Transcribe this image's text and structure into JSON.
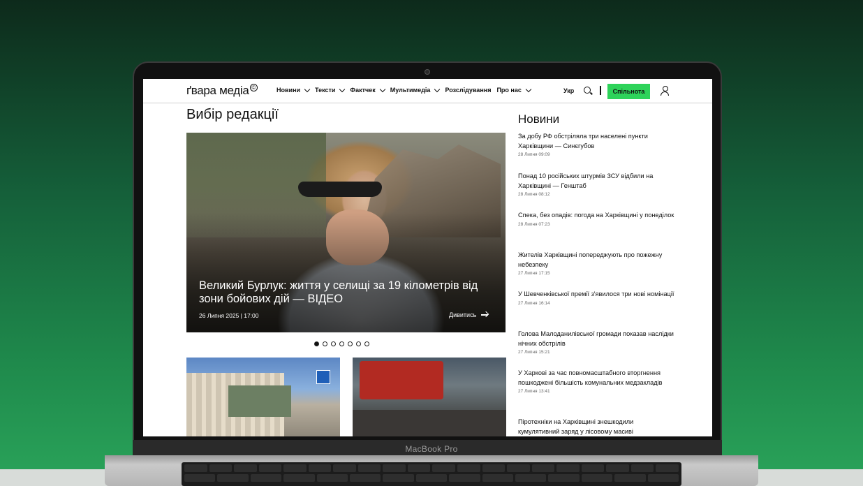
{
  "device": {
    "brand": "MacBook Pro"
  },
  "site": {
    "logo": "ґвара медіа",
    "logo_mark": "©",
    "nav": [
      {
        "label": "Новини",
        "dropdown": true
      },
      {
        "label": "Тексти",
        "dropdown": true
      },
      {
        "label": "Фактчек",
        "dropdown": true
      },
      {
        "label": "Мультимедіа",
        "dropdown": true
      },
      {
        "label": "Розслідування",
        "dropdown": false
      },
      {
        "label": "Про нас",
        "dropdown": true
      }
    ],
    "lang": "Укр",
    "community_button": "Спільнота",
    "accent_color": "#2ed35a"
  },
  "featured": {
    "section_title": "Вибір редакції",
    "hero_title": "Великий Бурлук: життя у селищі за 19 кілометрів від зони бойових дій — ВІДЕО",
    "hero_date": "26 Липня 2025 | 17:00",
    "hero_more": "Дивитись",
    "slides_total": 7,
    "slide_active": 1
  },
  "news": {
    "title": "Новини",
    "items": [
      {
        "title": "За добу РФ обстріляла три населені пункти Харківщини — Синєгубов",
        "date": "28 Липня 09:09"
      },
      {
        "title": "Понад 10 російських штурмів ЗСУ відбили на Харківщині — Генштаб",
        "date": "28 Липня 08:12"
      },
      {
        "title": "Спека, без опадів: погода на Харківщині у понеділок",
        "date": "28 Липня 07:23"
      },
      {
        "title": "Жителів Харківщині попереджують про пожежну небезпеку",
        "date": "27 Липня 17:15"
      },
      {
        "title": "У Шевченківської премії з'явилося три нові номінації",
        "date": "27 Липня 16:14"
      },
      {
        "title": "Голова Малоданилівської громади показав наслідки нічних обстрілів",
        "date": "27 Липня 15:21"
      },
      {
        "title": "У Харкові за час повномасштабного вторгнення пошкоджені більшість комунальних медзакладів",
        "date": "27 Липня 13:41"
      },
      {
        "title": "Піротехніки на Харківщині знешкодили кумулятивний заряд у лісовому масиві",
        "date": ""
      }
    ]
  }
}
